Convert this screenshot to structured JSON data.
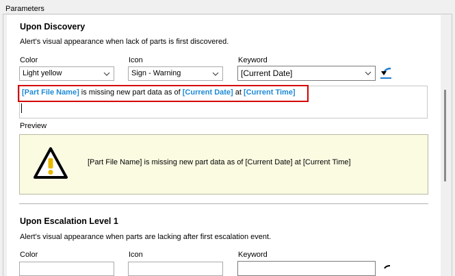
{
  "group_title": "Parameters",
  "discovery": {
    "title": "Upon Discovery",
    "description": "Alert's visual appearance when lack of parts is first discovered.",
    "color_label": "Color",
    "color_value": "Light yellow",
    "icon_label": "Icon",
    "icon_value": "Sign - Warning",
    "keyword_label": "Keyword",
    "keyword_value": "[Current Date]",
    "message": {
      "token1": "[Part File Name]",
      "text1": " is missing new part data as of ",
      "token2": "[Current Date]",
      "text2": " at ",
      "token3": "[Current Time]"
    },
    "preview_label": "Preview",
    "preview_text": "[Part File Name] is missing new part data as of [Current Date] at [Current Time]",
    "preview_color": "#fbfbe2"
  },
  "escalation1": {
    "title": "Upon Escalation Level 1",
    "description": "Alert's visual appearance when parts are lacking after first escalation event.",
    "color_label": "Color",
    "icon_label": "Icon",
    "keyword_label": "Keyword"
  },
  "colors": {
    "token": "#1e8ad6",
    "highlight": "#d40000",
    "insert_icon": "#1e7bd0"
  },
  "icons": {
    "dropdown": "chevron-down-icon",
    "insert": "insert-keyword-icon",
    "preview": "warning-triangle-icon"
  }
}
